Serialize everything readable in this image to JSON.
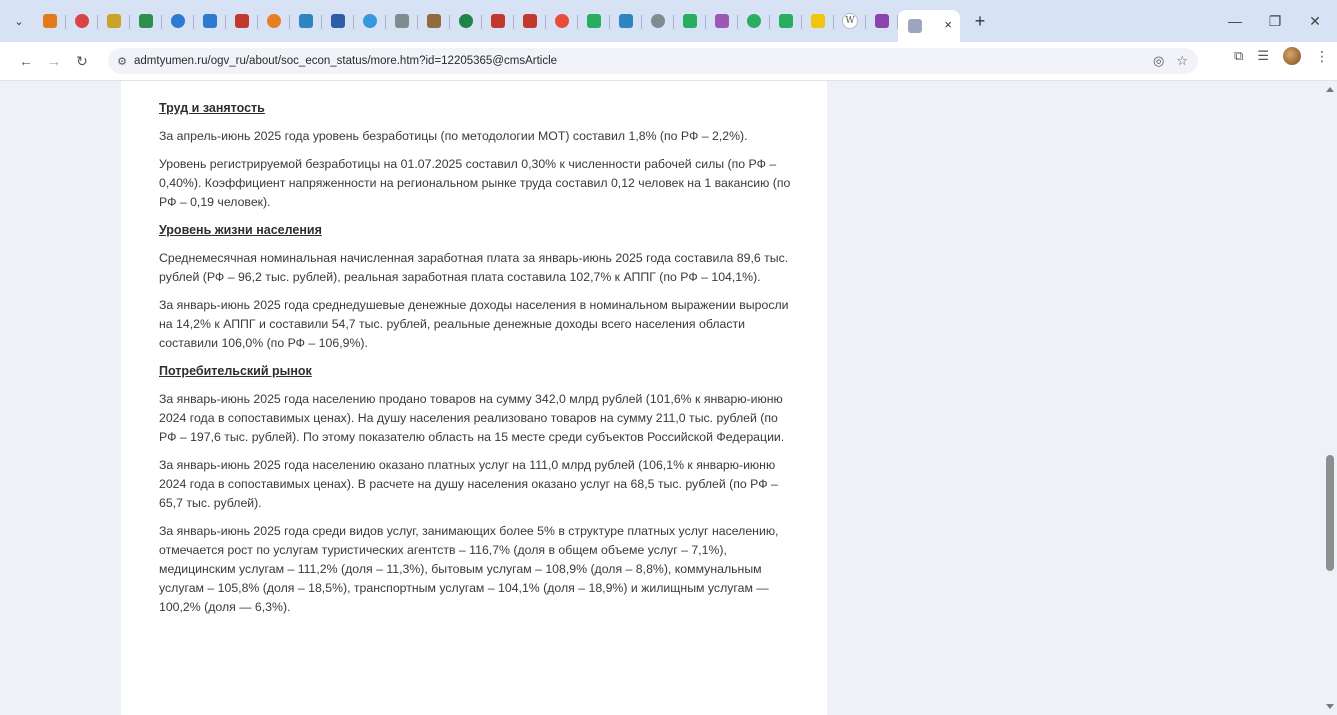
{
  "tabs": {
    "favicons": [
      {
        "icon": "ruler-icon",
        "color": "#e07a1a"
      },
      {
        "icon": "heart-icon",
        "color": "#d94545"
      },
      {
        "icon": "square-icon",
        "color": "#c9a227"
      },
      {
        "icon": "grid-icon",
        "color": "#2f8f4e"
      },
      {
        "icon": "globe-icon",
        "color": "#2c7bd1"
      },
      {
        "icon": "globe-icon",
        "color": "#2c7bd1"
      },
      {
        "icon": "flag-icon",
        "color": "#c0392b"
      },
      {
        "icon": "circle-icon",
        "color": "#e67e22"
      },
      {
        "icon": "image-icon",
        "color": "#2e86c1"
      },
      {
        "icon": "doc-icon",
        "color": "#2c5fa8"
      },
      {
        "icon": "drop-icon",
        "color": "#3498db"
      },
      {
        "icon": "gear-icon",
        "color": "#7f8c8d"
      },
      {
        "icon": "emblem-icon",
        "color": "#8e6c3b"
      },
      {
        "icon": "wave-icon",
        "color": "#1e8449"
      },
      {
        "icon": "emblem-icon",
        "color": "#c0392b"
      },
      {
        "icon": "home-icon",
        "color": "#c0392b"
      },
      {
        "icon": "dot-icon",
        "color": "#e74c3c"
      },
      {
        "icon": "emblem-icon",
        "color": "#27ae60"
      },
      {
        "icon": "box-icon",
        "color": "#2e86c1"
      },
      {
        "icon": "emblem-icon",
        "color": "#7f8c8d"
      },
      {
        "icon": "chart-icon",
        "color": "#27ae60"
      },
      {
        "icon": "emblem-icon",
        "color": "#9b59b6"
      },
      {
        "icon": "emblem-icon",
        "color": "#27ae60"
      },
      {
        "icon": "emblem-icon",
        "color": "#27ae60"
      },
      {
        "icon": "star-icon",
        "color": "#f1c40f"
      },
      {
        "icon": "wikipedia-icon",
        "color": "#555555",
        "glyph": "W"
      },
      {
        "icon": "shield-icon",
        "color": "#8e44ad"
      }
    ],
    "active_favicon": {
      "icon": "page-icon",
      "color": "#9aa7bf"
    }
  },
  "toolbar": {
    "url": "admtyumen.ru/ogv_ru/about/soc_econ_status/more.htm?id=12205365@cmsArticle"
  },
  "article": {
    "sections": [
      {
        "heading": "Труд и занятость",
        "paragraphs": [
          "За апрель-июнь 2025 года уровень безработицы (по методологии МОТ) составил 1,8% (по РФ – 2,2%).",
          "Уровень регистрируемой безработицы на 01.07.2025 составил 0,30% к численности рабочей силы (по РФ – 0,40%). Коэффициент напряженности на региональном рынке труда составил 0,12 человек на 1 вакансию (по РФ – 0,19 человек)."
        ]
      },
      {
        "heading": "Уровень жизни населения",
        "paragraphs": [
          "Среднемесячная номинальная начисленная заработная плата за январь-июнь 2025 года составила 89,6 тыс. рублей (РФ – 96,2 тыс. рублей), реальная заработная плата составила 102,7% к АППГ (по РФ – 104,1%).",
          "За январь-июнь 2025 года среднедушевые денежные доходы населения в номинальном выражении выросли на 14,2% к АППГ и составили 54,7 тыс. рублей, реальные денежные доходы всего населения области составили 106,0% (по РФ – 106,9%)."
        ]
      },
      {
        "heading": "Потребительский рынок",
        "paragraphs": [
          "За январь-июнь 2025 года населению продано товаров на сумму 342,0 млрд рублей (101,6% к январю-июню 2024 года в сопоставимых ценах). На душу населения реализовано товаров на сумму 211,0 тыс. рублей (по РФ – 197,6 тыс. рублей). По этому показателю область на 15 месте среди субъектов Российской Федерации.",
          "За январь-июнь 2025 года населению оказано платных услуг на 111,0 млрд рублей (106,1% к январю-июню 2024 года в сопоставимых ценах). В расчете на душу населения оказано услуг на 68,5 тыс. рублей (по РФ – 65,7 тыс. рублей).",
          "За январь-июнь 2025 года среди видов услуг, занимающих более 5% в структуре платных услуг населению, отмечается рост по услугам туристических агентств – 116,7% (доля в общем объеме услуг – 7,1%), медицинским услугам – 111,2% (доля – 11,3%), бытовым услугам – 108,9% (доля – 8,8%), коммунальным услугам – 105,8% (доля – 18,5%), транспортным услугам – 104,1% (доля – 18,9%) и жилищным услугам — 100,2% (доля — 6,3%)."
        ]
      }
    ]
  }
}
